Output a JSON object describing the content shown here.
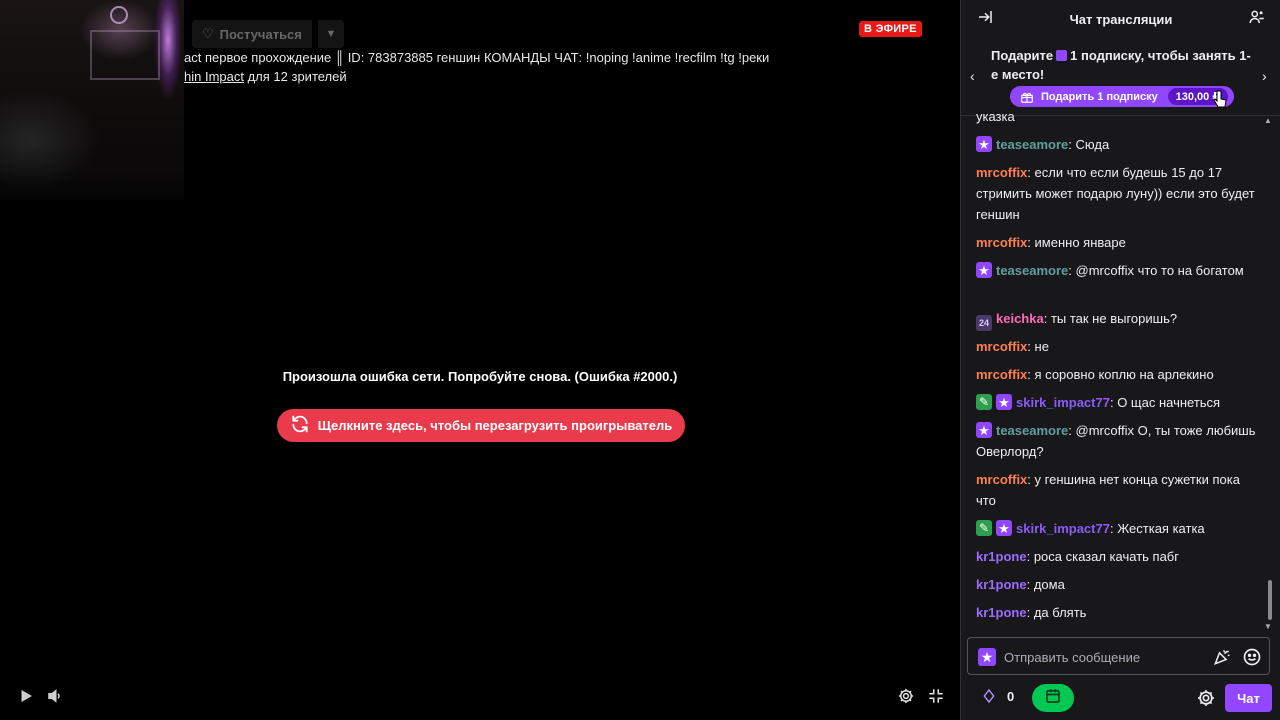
{
  "player": {
    "follow_label": "Постучаться",
    "live_badge": "В ЭФИРЕ",
    "title": "act первое прохождение ║ ID: 783873885 геншин КОМАНДЫ ЧАТ: !noping !anime !recfilm !tg !реки",
    "sub_game": "hin Impact",
    "sub_rest": " для 12 зрителей",
    "error_message": "Произошла ошибка сети. Попробуйте снова. (Ошибка #2000.)",
    "reload_label": "Щелкните здесь, чтобы перезагрузить проигрыватель"
  },
  "chat": {
    "title": "Чат трансляции",
    "promo": {
      "line_before": "Подарите",
      "line_after": "1 подписку, чтобы занять 1-е место!",
      "button_label": "Подарить 1 подписку",
      "price": "130,00 ₽"
    },
    "messages": [
      {
        "user": "",
        "text": "указка",
        "badges": [],
        "color": "#efeff1",
        "top": 0
      },
      {
        "user": "teaseamore",
        "text": "Сюда",
        "badges": [
          "star"
        ],
        "color": "#5f9ea0"
      },
      {
        "user": "mrcoffix",
        "text": "если что если будешь 15 до 17 стримить может подарю луну)) если это будет геншин",
        "badges": [],
        "color": "#ff7f50"
      },
      {
        "user": "mrcoffix",
        "text": "именно январе",
        "badges": [],
        "color": "#ff7f50"
      },
      {
        "user": "teaseamore",
        "text": "@mrcoffix что то на богатом",
        "badges": [
          "star"
        ],
        "color": "#5f9ea0"
      },
      {
        "user": "keichka",
        "text": "ты так не выгоришь?",
        "badges": [
          "num"
        ],
        "color": "#ff69b4"
      },
      {
        "user": "mrcoffix",
        "text": "не",
        "badges": [],
        "color": "#ff7f50"
      },
      {
        "user": "mrcoffix",
        "text": "я соровно коплю на арлекино",
        "badges": [],
        "color": "#ff7f50"
      },
      {
        "user": "skirk_impact77",
        "text": "О щас начнеться",
        "badges": [
          "green",
          "star"
        ],
        "color": "#8a5cf6"
      },
      {
        "user": "teaseamore",
        "text": "@mrcoffix О, ты тоже любишь Оверлорд?",
        "badges": [
          "star"
        ],
        "color": "#5f9ea0"
      },
      {
        "user": "mrcoffix",
        "text": "у геншина нет конца сужетки пока что",
        "badges": [],
        "color": "#ff7f50"
      },
      {
        "user": "skirk_impact77",
        "text": "Жесткая катка",
        "badges": [
          "green",
          "star"
        ],
        "color": "#8a5cf6"
      },
      {
        "user": "kr1pone",
        "text": "роса сказал качать пабг",
        "badges": [],
        "color": "#9d6bff"
      },
      {
        "user": "kr1pone",
        "text": "дома",
        "badges": [],
        "color": "#9d6bff"
      },
      {
        "user": "kr1pone",
        "text": "да блять",
        "badges": [],
        "color": "#9d6bff"
      }
    ],
    "input_placeholder": "Отправить сообщение",
    "points": "0",
    "chat_button": "Чат"
  }
}
